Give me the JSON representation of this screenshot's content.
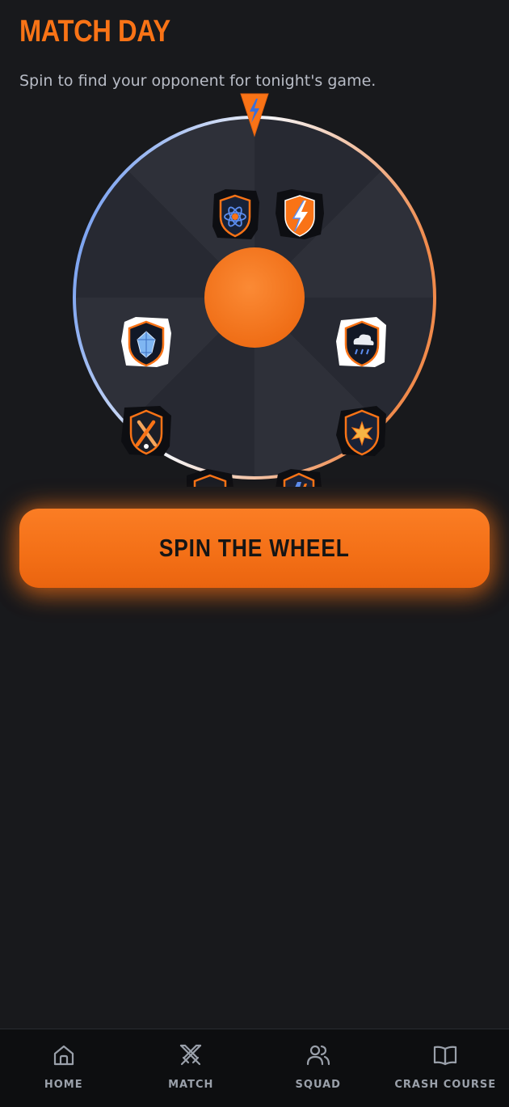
{
  "header": {
    "title": "MATCH DAY",
    "subtitle": "Spin to find your opponent for tonight's game."
  },
  "wheel": {
    "center_color": "#f97316",
    "pointer_icon": "lightning-bolt-icon",
    "segments": [
      {
        "icon": "atom-shield-icon"
      },
      {
        "icon": "lightning-shield-icon"
      },
      {
        "icon": "storm-cloud-shield-icon"
      },
      {
        "icon": "starburst-shield-icon"
      },
      {
        "icon": "lightning-bolt-shield-icon"
      },
      {
        "icon": "red-helmet-shield-icon"
      },
      {
        "icon": "crossed-bats-shield-icon"
      },
      {
        "icon": "crystal-shield-icon"
      }
    ]
  },
  "actions": {
    "spin_label": "SPIN THE WHEEL"
  },
  "nav": {
    "items": [
      {
        "label": "HOME",
        "icon": "home-icon"
      },
      {
        "label": "MATCH",
        "icon": "crossed-swords-icon"
      },
      {
        "label": "SQUAD",
        "icon": "users-icon"
      },
      {
        "label": "CRASH COURSE",
        "icon": "book-icon"
      }
    ]
  },
  "colors": {
    "accent": "#f97316",
    "background": "#18191c",
    "ring_gradient_start": "#5b8def",
    "ring_gradient_end": "#f08a4b"
  }
}
